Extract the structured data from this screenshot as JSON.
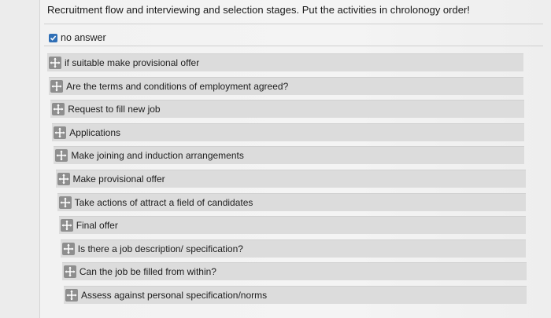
{
  "question": {
    "text": "Recruitment flow and interviewing and selection stages. Put the activities in chrolonogy order!"
  },
  "no_answer": {
    "label": "no answer",
    "checked": true
  },
  "items": [
    {
      "label": "if suitable make provisional offer"
    },
    {
      "label": "Are the terms and conditions of employment agreed?"
    },
    {
      "label": "Request to fill new job"
    },
    {
      "label": "Applications"
    },
    {
      "label": "Make joining and induction arrangements"
    },
    {
      "label": "Make provisional offer"
    },
    {
      "label": "Take actions of attract a field of candidates"
    },
    {
      "label": "Final offer"
    },
    {
      "label": "Is there a job description/ specification?"
    },
    {
      "label": "Can the job be filled from within?"
    },
    {
      "label": "Assess against personal specification/norms"
    }
  ],
  "colors": {
    "checkbox": "#2f6fb6",
    "item_background": "#dcdcdc",
    "handle": "#8e8e8e"
  },
  "icons": {
    "handle": "move-arrows-icon",
    "checkbox": "checkmark-icon"
  }
}
